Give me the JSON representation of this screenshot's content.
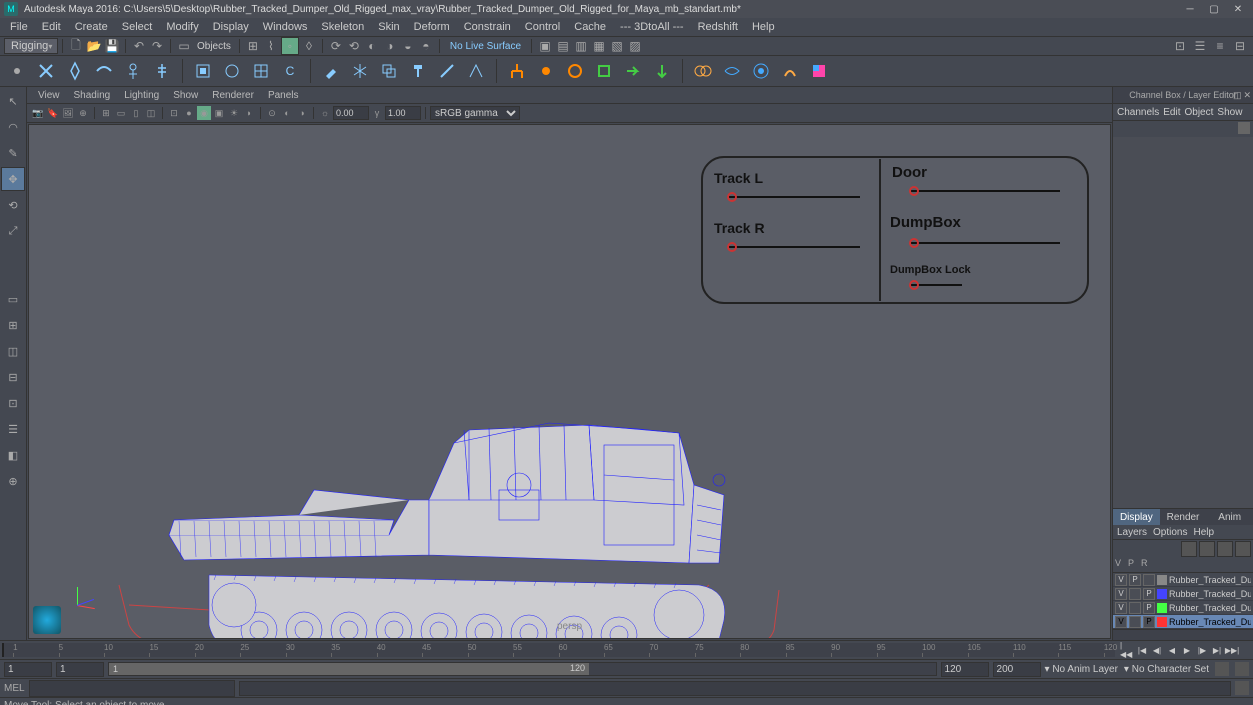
{
  "titlebar": {
    "title": "Autodesk Maya 2016: C:\\Users\\5\\Desktop\\Rubber_Tracked_Dumper_Old_Rigged_max_vray\\Rubber_Tracked_Dumper_Old_Rigged_for_Maya_mb_standart.mb*"
  },
  "mainmenu": [
    "File",
    "Edit",
    "Create",
    "Select",
    "Modify",
    "Display",
    "Windows",
    "Skeleton",
    "Skin",
    "Deform",
    "Constrain",
    "Control",
    "Cache",
    "--- 3DtoAll ---",
    "Redshift",
    "Help"
  ],
  "statusline": {
    "dropdown": "Rigging",
    "mask_label": "Objects",
    "surface_label": "No Live Surface"
  },
  "panel": {
    "menu": [
      "View",
      "Shading",
      "Lighting",
      "Show",
      "Renderer",
      "Panels"
    ],
    "near": "0.00",
    "far": "1.00",
    "gamma": "sRGB gamma",
    "camera": "persp"
  },
  "viewport_controls": {
    "trackL": "Track L",
    "trackR": "Track R",
    "door": "Door",
    "dumpbox": "DumpBox",
    "dumpboxLock": "DumpBox Lock"
  },
  "rightpanel": {
    "title": "Channel Box / Layer Editor",
    "menu": [
      "Channels",
      "Edit",
      "Object",
      "Show"
    ],
    "layer_tabs": [
      "Display",
      "Render",
      "Anim"
    ],
    "layer_menu": [
      "Layers",
      "Options",
      "Help"
    ],
    "layer_head": [
      "V",
      "P",
      "R"
    ],
    "layers": [
      {
        "v": "V",
        "p": "P",
        "r": "",
        "color": "#888",
        "name": "Rubber_Tracked_Dumper_Old",
        "sel": false
      },
      {
        "v": "V",
        "p": "",
        "r": "P",
        "color": "#44f",
        "name": "Rubber_Tracked_Dump",
        "sel": false
      },
      {
        "v": "V",
        "p": "",
        "r": "P",
        "color": "#4f4",
        "name": "Rubber_Tracked_Dump",
        "sel": false
      },
      {
        "v": "V",
        "p": "",
        "r": "P",
        "color": "#f33",
        "name": "Rubber_Tracked_Dump",
        "sel": true
      }
    ]
  },
  "timeline": {
    "ticks": [
      "1",
      "5",
      "10",
      "15",
      "20",
      "25",
      "30",
      "35",
      "40",
      "45",
      "50",
      "55",
      "60",
      "65",
      "70",
      "75",
      "80",
      "85",
      "90",
      "95",
      "100",
      "105",
      "110",
      "115",
      "120"
    ],
    "start_outer": "1",
    "start_inner": "1",
    "current": "1",
    "end_inner": "120",
    "end_outer": "120",
    "end_range": "200",
    "anim_layer": "No Anim Layer",
    "char_set": "No Character Set"
  },
  "cmdline": {
    "label": "MEL"
  },
  "helpline": "Move Tool: Select an object to move."
}
